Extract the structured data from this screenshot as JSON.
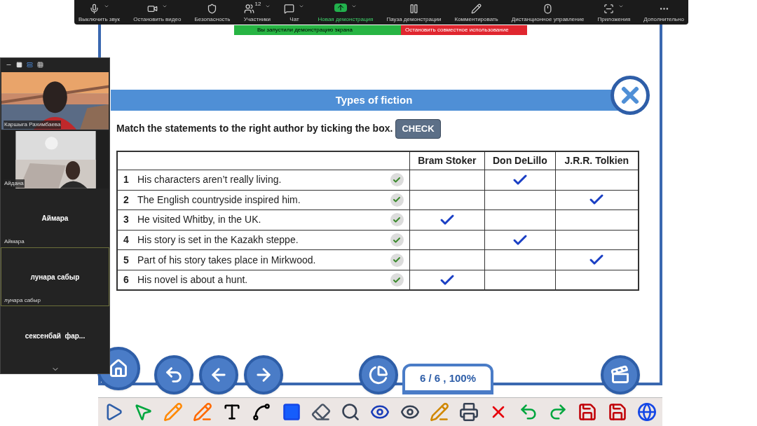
{
  "meeting_toolbar": [
    {
      "label": "Выключить звук",
      "caret": true,
      "active": false
    },
    {
      "label": "Остановить видео",
      "caret": true,
      "active": false
    },
    {
      "label": "Безопасность",
      "caret": false,
      "active": false
    },
    {
      "label": "Участники",
      "caret": true,
      "active": false,
      "badge": "12"
    },
    {
      "label": "Чат",
      "caret": true,
      "active": false
    },
    {
      "label": "Новая демонстрация",
      "caret": true,
      "active": true
    },
    {
      "label": "Пауза демонстрации",
      "caret": false,
      "active": false
    },
    {
      "label": "Комментировать",
      "caret": false,
      "active": false
    },
    {
      "label": "Дистанционное управление",
      "caret": false,
      "active": false
    },
    {
      "label": "Приложения",
      "caret": true,
      "active": false
    },
    {
      "label": "Дополнительно",
      "caret": false,
      "active": false
    }
  ],
  "share_banner": {
    "status": "Вы запустили демонстрацию экрана",
    "stop_button": "Остановить совместное использование"
  },
  "participants": [
    {
      "kind": "video",
      "name": "Каршыга Рахимбаева",
      "selected": false
    },
    {
      "kind": "video",
      "name": "Айдана",
      "selected": false
    },
    {
      "kind": "avatar",
      "display": "Аймара",
      "name": "Аймара",
      "selected": false
    },
    {
      "kind": "avatar",
      "display": "лунара сабыр",
      "name": "лунара сабыр",
      "selected": true
    },
    {
      "kind": "avatar",
      "display": "сексенбай  фар...",
      "selected": false
    }
  ],
  "exercise": {
    "title": "Types of fiction",
    "instruction": "Match the statements to the right author by ticking the box.",
    "check_button": "CHECK",
    "columns": [
      "Bram Stoker",
      "Don DeLillo",
      "J.R.R. Tolkien"
    ],
    "rows": [
      {
        "number": "1",
        "text": "His characters aren’t really living.",
        "correct": true,
        "ticks": [
          false,
          true,
          false
        ]
      },
      {
        "number": "2",
        "text": "The English countryside inspired him.",
        "correct": true,
        "ticks": [
          false,
          false,
          true
        ]
      },
      {
        "number": "3",
        "text": "He visited Whitby, in the UK.",
        "correct": true,
        "ticks": [
          true,
          false,
          false
        ]
      },
      {
        "number": "4",
        "text": "His story is set in the Kazakh steppe.",
        "correct": true,
        "ticks": [
          false,
          true,
          false
        ]
      },
      {
        "number": "5",
        "text": "Part of his story takes place in Mirkwood.",
        "correct": true,
        "ticks": [
          false,
          false,
          true
        ]
      },
      {
        "number": "6",
        "text": "His novel is about a hunt.",
        "correct": true,
        "ticks": [
          true,
          false,
          false
        ]
      }
    ]
  },
  "page_indicator": "6 / 6 , 100%"
}
